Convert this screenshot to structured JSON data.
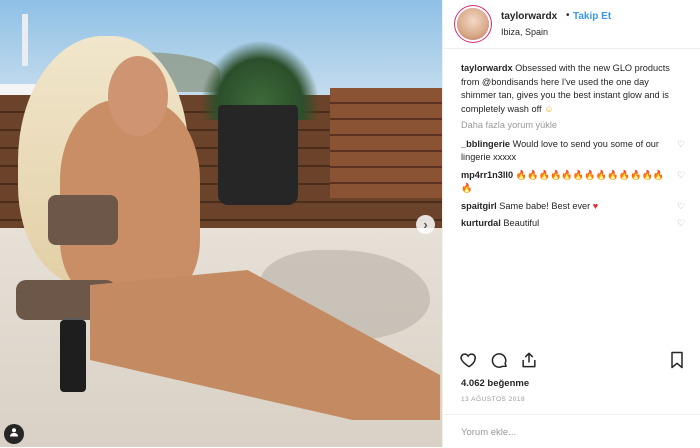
{
  "post": {
    "username": "taylorwardx",
    "dot": "•",
    "follow": "Takip Et",
    "location": "Ibiza, Spain",
    "caption_user": "taylorwardx",
    "caption_text": " Obsessed with the new GLO products from @bondisands here I've used the one day shimmer tan, gives you the best instant glow and is completely wash off ",
    "caption_emoji": "☺",
    "more_comments": "Daha fazla yorum yükle",
    "comments": [
      {
        "user": "_bblingerie",
        "text": " Would love to send you some of our lingerie xxxxx",
        "emoji": ""
      },
      {
        "user": "mp4rr1n3ll0",
        "text": " ",
        "emoji": "🔥🔥🔥🔥🔥🔥🔥🔥🔥🔥🔥🔥🔥🔥"
      },
      {
        "user": "spaitgirl",
        "text": " Same babe! Best ever ",
        "emoji": "♥"
      },
      {
        "user": "kurturdal",
        "text": " Beautiful",
        "emoji": ""
      }
    ],
    "likes": "4.062 beğenme",
    "date": "13 AĞUSTOS 2018",
    "add_comment_placeholder": "Yorum ekle..."
  },
  "icons": {
    "next": "›",
    "corner": "●",
    "like": "heart-outline-icon",
    "comment": "comment-bubble-icon",
    "share": "share-upload-icon",
    "save": "bookmark-icon"
  },
  "colors": {
    "follow": "#3897f0",
    "muted": "#999999",
    "text": "#262626"
  }
}
